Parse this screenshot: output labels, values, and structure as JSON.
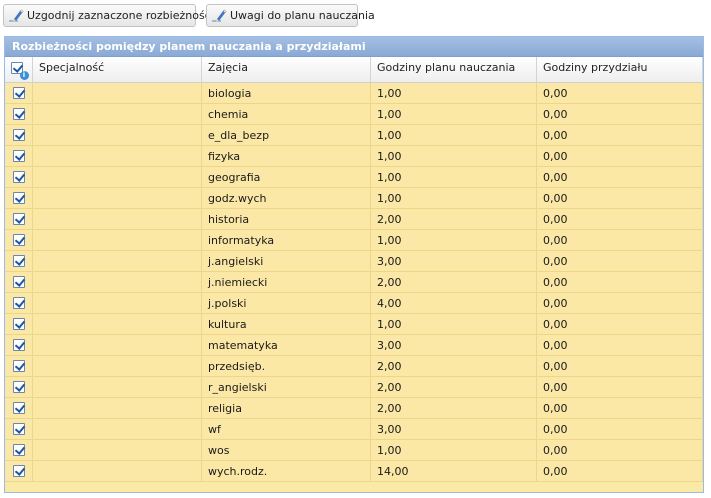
{
  "toolbar": {
    "reconcile_label": "Uzgodnij zaznaczone rozbieżności",
    "notes_label": "Uwagi do planu nauczania"
  },
  "panel": {
    "title": "Rozbieżności pomiędzy planem nauczania a przydziałami"
  },
  "columns": [
    "Specjalność",
    "Zajęcia",
    "Godziny planu nauczania",
    "Godziny przydziału"
  ],
  "rows": [
    {
      "checked": true,
      "specjalnosc": "",
      "zajecia": "biologia",
      "plan": "1,00",
      "przydzial": "0,00"
    },
    {
      "checked": true,
      "specjalnosc": "",
      "zajecia": "chemia",
      "plan": "1,00",
      "przydzial": "0,00"
    },
    {
      "checked": true,
      "specjalnosc": "",
      "zajecia": "e_dla_bezp",
      "plan": "1,00",
      "przydzial": "0,00"
    },
    {
      "checked": true,
      "specjalnosc": "",
      "zajecia": "fizyka",
      "plan": "1,00",
      "przydzial": "0,00"
    },
    {
      "checked": true,
      "specjalnosc": "",
      "zajecia": "geografia",
      "plan": "1,00",
      "przydzial": "0,00"
    },
    {
      "checked": true,
      "specjalnosc": "",
      "zajecia": "godz.wych",
      "plan": "1,00",
      "przydzial": "0,00"
    },
    {
      "checked": true,
      "specjalnosc": "",
      "zajecia": "historia",
      "plan": "2,00",
      "przydzial": "0,00"
    },
    {
      "checked": true,
      "specjalnosc": "",
      "zajecia": "informatyka",
      "plan": "1,00",
      "przydzial": "0,00"
    },
    {
      "checked": true,
      "specjalnosc": "",
      "zajecia": "j.angielski",
      "plan": "3,00",
      "przydzial": "0,00"
    },
    {
      "checked": true,
      "specjalnosc": "",
      "zajecia": "j.niemiecki",
      "plan": "2,00",
      "przydzial": "0,00"
    },
    {
      "checked": true,
      "specjalnosc": "",
      "zajecia": "j.polski",
      "plan": "4,00",
      "przydzial": "0,00"
    },
    {
      "checked": true,
      "specjalnosc": "",
      "zajecia": "kultura",
      "plan": "1,00",
      "przydzial": "0,00"
    },
    {
      "checked": true,
      "specjalnosc": "",
      "zajecia": "matematyka",
      "plan": "3,00",
      "przydzial": "0,00"
    },
    {
      "checked": true,
      "specjalnosc": "",
      "zajecia": "przedsięb.",
      "plan": "2,00",
      "przydzial": "0,00"
    },
    {
      "checked": true,
      "specjalnosc": "",
      "zajecia": "r_angielski",
      "plan": "2,00",
      "przydzial": "0,00"
    },
    {
      "checked": true,
      "specjalnosc": "",
      "zajecia": "religia",
      "plan": "2,00",
      "przydzial": "0,00"
    },
    {
      "checked": true,
      "specjalnosc": "",
      "zajecia": "wf",
      "plan": "3,00",
      "przydzial": "0,00"
    },
    {
      "checked": true,
      "specjalnosc": "",
      "zajecia": "wos",
      "plan": "1,00",
      "przydzial": "0,00"
    },
    {
      "checked": true,
      "specjalnosc": "",
      "zajecia": "wych.rodz.",
      "plan": "14,00",
      "przydzial": "0,00"
    }
  ],
  "colors": {
    "row_background": "#fbe8a6",
    "panel_header": "#8aa9d5"
  }
}
